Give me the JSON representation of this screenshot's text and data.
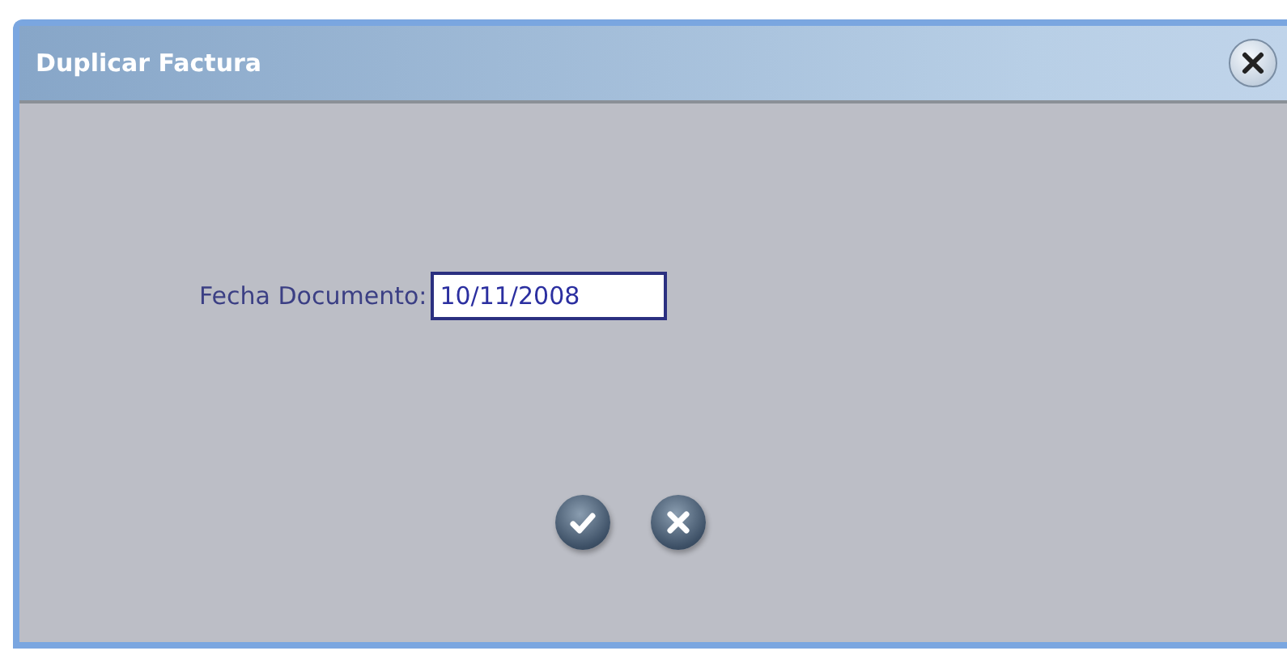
{
  "window": {
    "title": "Duplicar Factura"
  },
  "form": {
    "label": "Fecha Documento:",
    "value": "10/11/2008"
  }
}
